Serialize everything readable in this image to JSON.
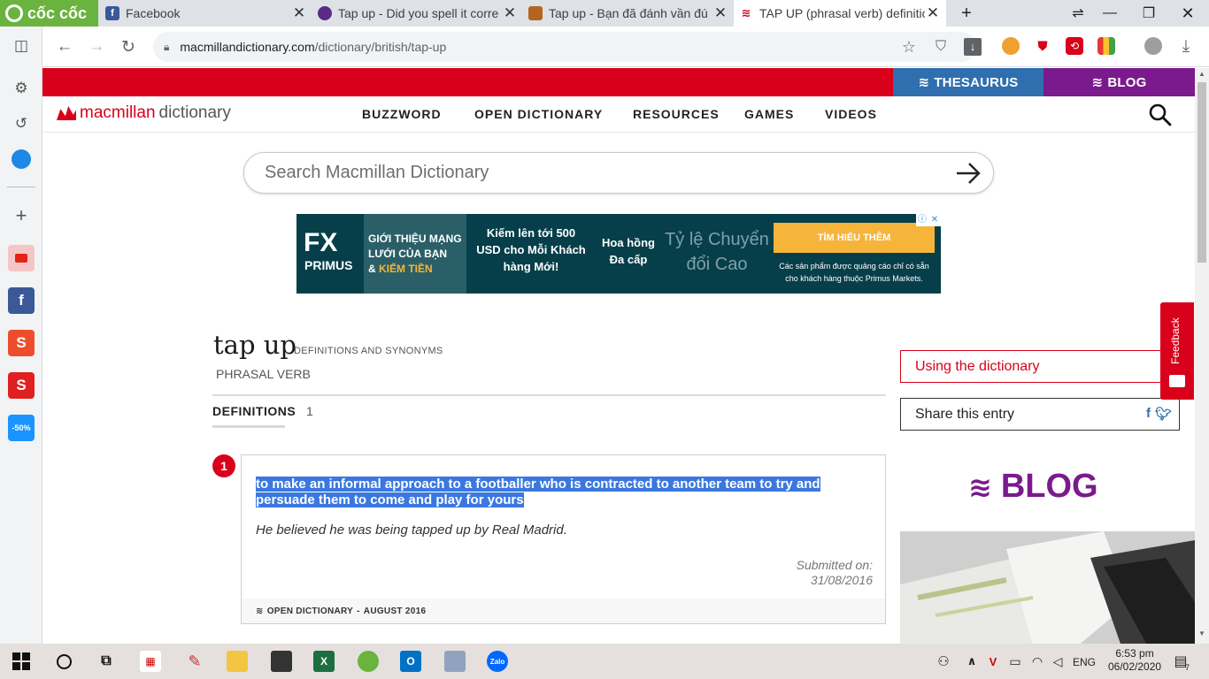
{
  "browser": {
    "brand": "cốc cốc",
    "tabs": [
      {
        "title": "Facebook",
        "active": false
      },
      {
        "title": "Tap up - Did you spell it corre",
        "active": false
      },
      {
        "title": "Tap up - Bạn đã đánh vần đú",
        "active": false
      },
      {
        "title": "TAP UP (phrasal verb) definitio",
        "active": true
      }
    ],
    "url_host": "macmillandictionary.com",
    "url_path": "/dictionary/british/tap-up"
  },
  "site": {
    "topbar": {
      "thesaurus": "THESAURUS",
      "blog": "BLOG"
    },
    "logo_brand": "macmillan",
    "logo_word": "dictionary",
    "nav": [
      "BUZZWORD",
      "OPEN DICTIONARY",
      "RESOURCES",
      "GAMES",
      "VIDEOS"
    ],
    "search_placeholder": "Search Macmillan Dictionary"
  },
  "ad": {
    "brand_top": "FX",
    "brand_bottom": "PRIMUS",
    "panel1_line1": "GIỚI THIỆU MẠNG",
    "panel1_line2": "LƯỚI CỦA BẠN",
    "panel1_line3_prefix": "&",
    "panel1_line3_gold": "KIẾM TIỀN",
    "panel2": "Kiếm lên tới 500 USD cho Mỗi Khách hàng Mới!",
    "panel3": "Hoa hồng Đa cấp",
    "panel4": "Tỷ lệ Chuyển đổi Cao",
    "cta": "TÌM HIỂU THÊM",
    "note": "Các sản phẩm được quảng cáo chỉ có sẵn cho khách hàng thuộc Primus Markets."
  },
  "entry": {
    "headword": "tap up",
    "headword_sub": "DEFINITIONS AND SYNONYMS",
    "part_of_speech": "PHRASAL VERB",
    "defs_tab": "DEFINITIONS",
    "defs_count": "1",
    "senses": [
      {
        "number": "1",
        "definition_line1": "to make an informal approach to a footballer who is contracted to another team to try and",
        "definition_line2": "persuade them to come and play for yours",
        "example": "He believed he was being tapped up by Real Madrid.",
        "submitted_label": "Submitted on:",
        "submitted_date": "31/08/2016",
        "source": "OPEN DICTIONARY",
        "source_date": "AUGUST 2016"
      }
    ]
  },
  "sidebar_right": {
    "using": "Using the dictionary",
    "share": "Share this entry",
    "feedback": "Feedback",
    "blog": "BLOG"
  },
  "taskbar": {
    "language": "ENG",
    "time": "6:53 pm",
    "date": "06/02/2020",
    "notifications": "7"
  },
  "colors": {
    "macmillan_red": "#d9001b",
    "thesaurus_blue": "#2f6fb0",
    "blog_purple": "#7a1a8c",
    "selection_blue": "#3a78e0",
    "coccoc_green": "#69b33e"
  }
}
